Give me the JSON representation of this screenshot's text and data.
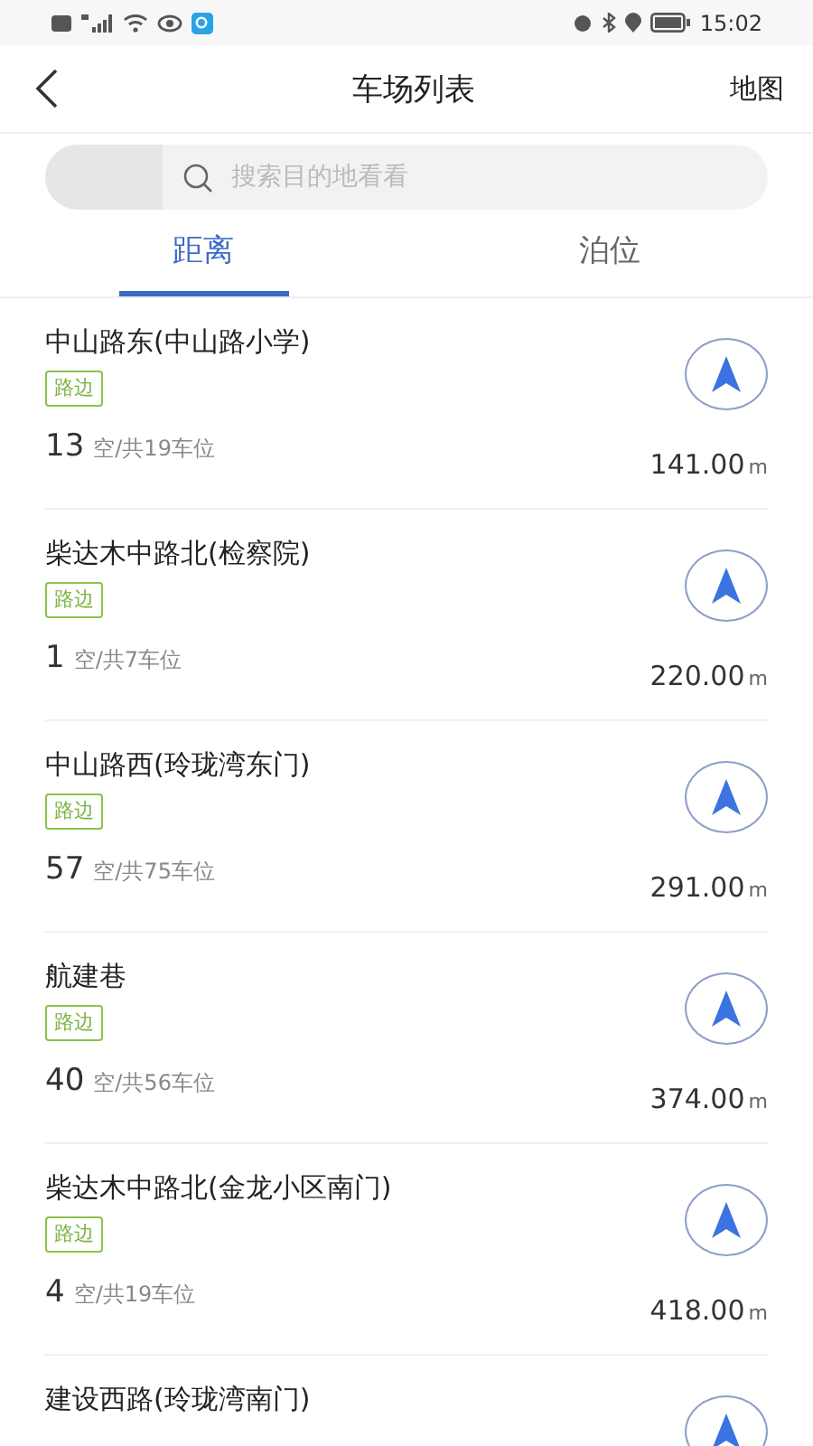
{
  "status_bar": {
    "time": "15:02"
  },
  "header": {
    "title": "车场列表",
    "action": "地图"
  },
  "search": {
    "placeholder": "搜索目的地看看"
  },
  "tabs": [
    {
      "label": "距离",
      "selected": true
    },
    {
      "label": "泊位",
      "selected": false
    }
  ],
  "lots": [
    {
      "name": "中山路东(中山路小学)",
      "tag": "路边",
      "free": "13",
      "total": "空/共19车位",
      "distance": "141.00",
      "unit": "m"
    },
    {
      "name": "柴达木中路北(检察院)",
      "tag": "路边",
      "free": "1",
      "total": "空/共7车位",
      "distance": "220.00",
      "unit": "m"
    },
    {
      "name": "中山路西(玲珑湾东门)",
      "tag": "路边",
      "free": "57",
      "total": "空/共75车位",
      "distance": "291.00",
      "unit": "m"
    },
    {
      "name": "航建巷",
      "tag": "路边",
      "free": "40",
      "total": "空/共56车位",
      "distance": "374.00",
      "unit": "m"
    },
    {
      "name": "柴达木中路北(金龙小区南门)",
      "tag": "路边",
      "free": "4",
      "total": "空/共19车位",
      "distance": "418.00",
      "unit": "m"
    },
    {
      "name": "建设西路(玲珑湾南门)"
    }
  ]
}
